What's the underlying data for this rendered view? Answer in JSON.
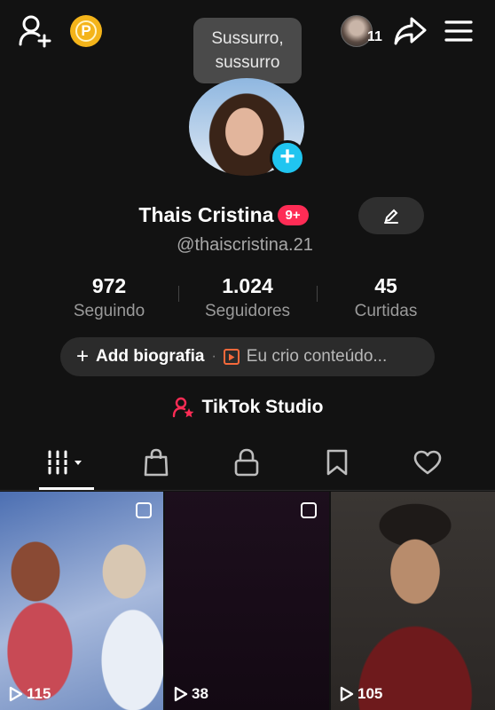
{
  "header": {
    "tooltip": "Sussurro,\nsussurro",
    "tooltip_lines": [
      "Sussurro,",
      "sussurro"
    ],
    "friends_count": "11",
    "icons": [
      "add-user-icon",
      "coin-icon",
      "share-icon",
      "menu-icon"
    ]
  },
  "profile": {
    "name": "Thais Cristina",
    "badge": "9+",
    "handle": "@thaiscristina.21"
  },
  "stats": [
    {
      "value": "972",
      "label": "Seguindo"
    },
    {
      "value": "1.024",
      "label": "Seguidores"
    },
    {
      "value": "45",
      "label": "Curtidas"
    }
  ],
  "bio": {
    "add_label": "Add biografia",
    "creator_label": "Eu crio conteúdo..."
  },
  "studio": {
    "label": "TikTok Studio"
  },
  "tabs": [
    "grid-icon",
    "shop-icon",
    "lock-icon",
    "bookmark-icon",
    "heart-icon"
  ],
  "videos": [
    {
      "views": "115"
    },
    {
      "views": "38"
    },
    {
      "views": "105"
    }
  ],
  "colors": {
    "background": "#121212",
    "accent_pink": "#fe2c55",
    "accent_cyan": "#20c5f0",
    "coin": "#f4b41a"
  }
}
